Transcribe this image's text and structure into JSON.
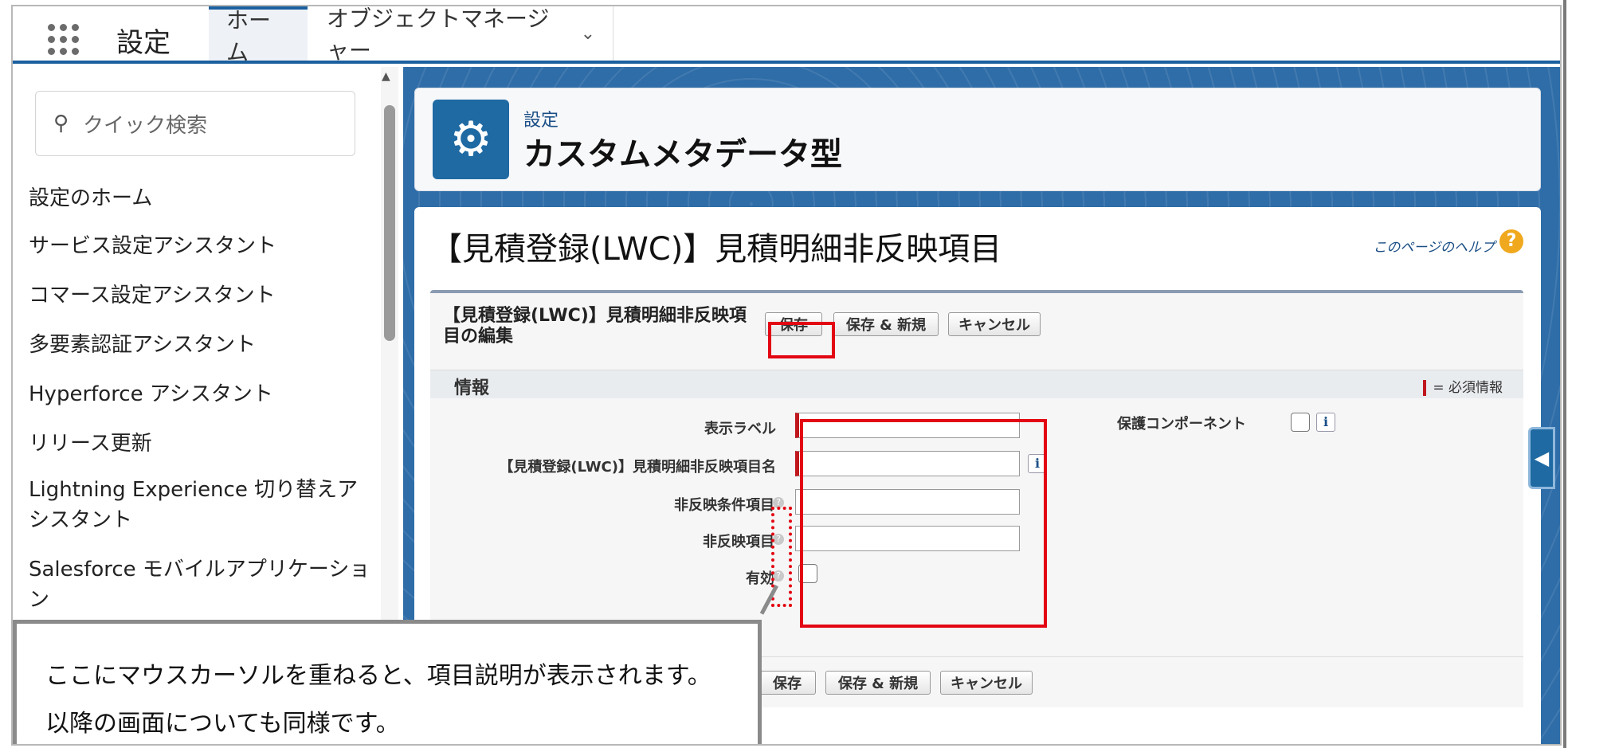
{
  "topbar": {
    "app_name": "設定",
    "tabs": [
      {
        "label": "ホーム"
      },
      {
        "label": "オブジェクトマネージャー"
      }
    ]
  },
  "sidebar": {
    "search_placeholder": "クイック検索",
    "items": [
      {
        "label": "設定のホーム"
      },
      {
        "label": "サービス設定アシスタント"
      },
      {
        "label": "コマース設定アシスタント"
      },
      {
        "label": "多要素認証アシスタント"
      },
      {
        "label": "Hyperforce アシスタント"
      },
      {
        "label": "リリース更新"
      },
      {
        "label": "Lightning Experience 切り替えアシスタント"
      },
      {
        "label": "Salesforce モバイルアプリケーション"
      }
    ]
  },
  "header": {
    "breadcrumb": "設定",
    "title": "カスタムメタデータ型"
  },
  "page": {
    "title": "【見積登録(LWC)】見積明細非反映項目",
    "help_link": "このページのヘルプ",
    "help_icon": "?"
  },
  "edit": {
    "title": "【見積登録(LWC)】見積明細非反映項目の編集",
    "save": "保存",
    "save_new": "保存 & 新規",
    "cancel": "キャンセル",
    "section_title": "情報",
    "required_legend": "= 必須情報",
    "fields": {
      "label": "表示ラベル",
      "api_name": "【見積登録(LWC)】見積明細非反映項目名",
      "condition_field": "非反映条件項目",
      "excluded_field": "非反映項目",
      "active": "有効",
      "protected": "保護コンポーネント"
    }
  },
  "callout": {
    "line1": "ここにマウスカーソルを重ねると、項目説明が表示されます。",
    "line2": "以降の画面についても同様です。"
  },
  "colors": {
    "brand": "#1f6aa3",
    "highlight": "#e30613",
    "required": "#c0171e"
  }
}
